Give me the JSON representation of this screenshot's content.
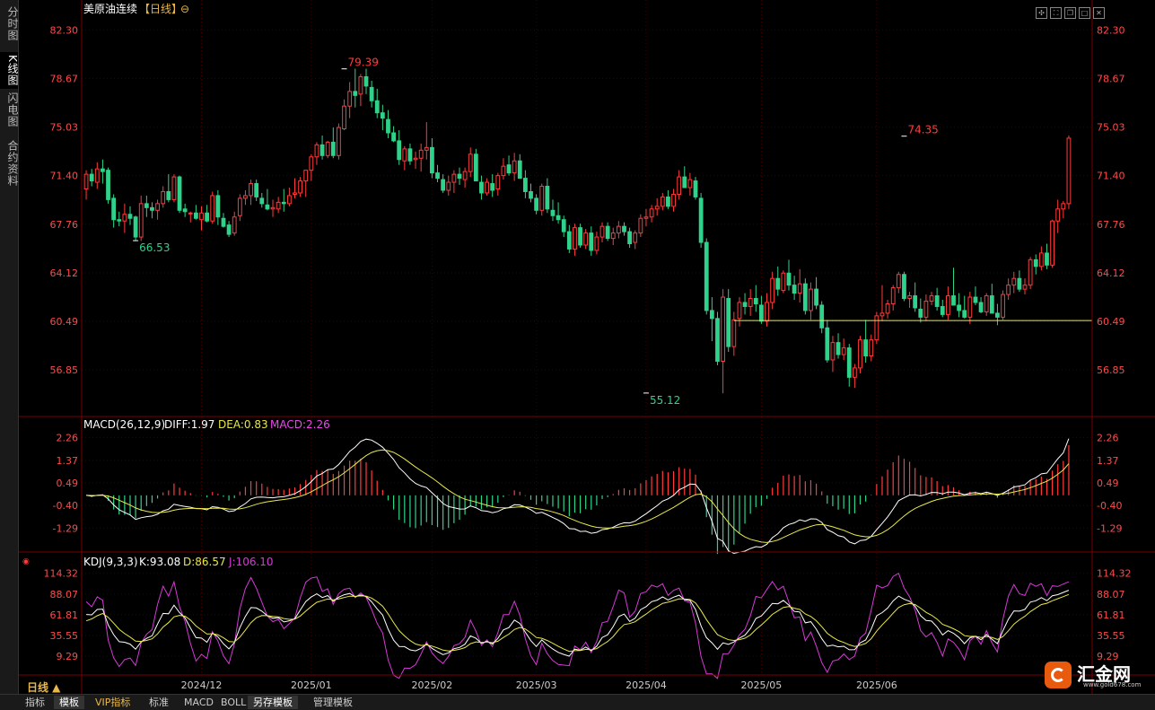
{
  "sidebar": {
    "tabs": [
      {
        "label": "分时图",
        "active": false
      },
      {
        "label": "K线图",
        "active": true
      },
      {
        "label": "闪电图",
        "active": false
      },
      {
        "label": "合约资料",
        "active": false
      }
    ]
  },
  "header": {
    "title": "美原油连续",
    "period_bracket": "【日线】",
    "settings_glyph": "⊖"
  },
  "window_icons": [
    "move-icon",
    "fullscreen-icon",
    "restore-icon",
    "max-icon",
    "close-icon"
  ],
  "period_label": "日线 ▲",
  "toolbar": {
    "buttons": [
      {
        "label": "指标",
        "active": false,
        "vip": false
      },
      {
        "label": "模板",
        "active": true,
        "vip": false
      },
      {
        "label": "VIP指标",
        "active": false,
        "vip": true
      },
      {
        "label": "标准",
        "active": false,
        "vip": false
      },
      {
        "label": "MACD",
        "active": false,
        "vip": false
      },
      {
        "label": "BOLL",
        "active": false,
        "vip": false
      },
      {
        "label": "另存模板",
        "active": true,
        "vip": false
      },
      {
        "label": "管理模板",
        "active": false,
        "vip": false
      }
    ]
  },
  "logo": {
    "text": "汇金网",
    "url": "www.gold678.com"
  },
  "colors": {
    "up": "#ff3b3b",
    "down": "#2fd28a",
    "price_axis": "#ff4a4a",
    "dea": "#e8e84a",
    "macd_label": "#e84ae8",
    "k": "#ffffff",
    "d": "#e8e84a",
    "j": "#d63ad6",
    "grid": "#3a0000",
    "hline": "#e8e85a"
  },
  "chart_data": [
    {
      "type": "candlestick",
      "yticks": [
        "82.30",
        "78.67",
        "75.03",
        "71.40",
        "67.76",
        "64.12",
        "60.49",
        "56.85"
      ],
      "ylim": [
        53.5,
        83.2
      ],
      "x_ticks": [
        {
          "label": "2024/12",
          "index": 21
        },
        {
          "label": "2025/01",
          "index": 41
        },
        {
          "label": "2025/02",
          "index": 63
        },
        {
          "label": "2025/03",
          "index": 82
        },
        {
          "label": "2025/04",
          "index": 102
        },
        {
          "label": "2025/05",
          "index": 123
        },
        {
          "label": "2025/06",
          "index": 144
        }
      ],
      "annotations": [
        {
          "text": "79.39",
          "index": 47,
          "value": 79.39,
          "kind": "high"
        },
        {
          "text": "66.53",
          "index": 9,
          "value": 66.53,
          "kind": "low"
        },
        {
          "text": "55.12",
          "index": 102,
          "value": 55.12,
          "kind": "low"
        },
        {
          "text": "74.35",
          "index": 149,
          "value": 74.35,
          "kind": "high"
        }
      ],
      "hline": {
        "value": 60.55,
        "from_index": 118,
        "to_index": 154
      },
      "ohlc": [
        [
          70.4,
          71.8,
          69.6,
          71.5
        ],
        [
          71.5,
          71.9,
          70.6,
          71.0
        ],
        [
          70.9,
          72.4,
          70.4,
          71.9
        ],
        [
          71.9,
          72.6,
          70.8,
          71.7
        ],
        [
          71.8,
          72.0,
          69.3,
          69.6
        ],
        [
          69.7,
          70.0,
          67.5,
          68.1
        ],
        [
          68.1,
          68.7,
          67.6,
          68.0
        ],
        [
          68.0,
          69.3,
          67.1,
          68.5
        ],
        [
          68.5,
          69.1,
          67.7,
          68.2
        ],
        [
          68.3,
          68.4,
          66.5,
          66.8
        ],
        [
          66.8,
          69.9,
          66.5,
          69.3
        ],
        [
          69.3,
          69.9,
          68.3,
          69.0
        ],
        [
          69.0,
          69.4,
          68.2,
          68.8
        ],
        [
          68.8,
          69.6,
          68.1,
          69.3
        ],
        [
          69.3,
          70.6,
          69.0,
          70.2
        ],
        [
          70.2,
          71.5,
          69.4,
          69.6
        ],
        [
          69.6,
          71.5,
          69.4,
          71.3
        ],
        [
          71.3,
          71.4,
          68.6,
          68.8
        ],
        [
          68.9,
          69.3,
          68.3,
          68.7
        ],
        [
          68.6,
          68.7,
          67.9,
          68.6
        ],
        [
          68.6,
          69.2,
          68.1,
          68.2
        ],
        [
          68.1,
          69.1,
          67.3,
          68.6
        ],
        [
          68.6,
          69.2,
          67.9,
          68.0
        ],
        [
          68.0,
          70.2,
          67.8,
          69.9
        ],
        [
          69.9,
          70.3,
          67.7,
          68.3
        ],
        [
          68.2,
          68.6,
          67.5,
          67.6
        ],
        [
          67.7,
          68.0,
          66.8,
          67.0
        ],
        [
          67.1,
          68.7,
          66.9,
          68.3
        ],
        [
          68.4,
          70.0,
          68.0,
          69.7
        ],
        [
          69.7,
          70.3,
          69.2,
          69.9
        ],
        [
          69.9,
          71.1,
          69.2,
          70.8
        ],
        [
          70.8,
          71.1,
          69.5,
          69.8
        ],
        [
          69.7,
          70.1,
          69.0,
          69.3
        ],
        [
          69.2,
          70.4,
          68.8,
          68.9
        ],
        [
          68.9,
          69.6,
          68.3,
          69.0
        ],
        [
          68.9,
          69.8,
          68.6,
          69.4
        ],
        [
          69.4,
          70.4,
          68.7,
          69.3
        ],
        [
          69.3,
          70.5,
          69.1,
          69.9
        ],
        [
          70.0,
          71.2,
          69.7,
          70.1
        ],
        [
          70.1,
          71.3,
          69.8,
          71.0
        ],
        [
          71.0,
          71.8,
          69.8,
          71.8
        ],
        [
          71.8,
          73.0,
          71.0,
          72.8
        ],
        [
          72.8,
          73.9,
          72.2,
          73.7
        ],
        [
          73.7,
          74.4,
          72.6,
          72.9
        ],
        [
          72.9,
          74.0,
          72.7,
          73.9
        ],
        [
          73.9,
          75.0,
          72.7,
          72.9
        ],
        [
          72.9,
          75.3,
          72.6,
          75.0
        ],
        [
          74.9,
          77.1,
          74.8,
          76.6
        ],
        [
          76.6,
          78.4,
          75.7,
          77.7
        ],
        [
          77.7,
          79.4,
          76.5,
          77.4
        ],
        [
          77.5,
          79.0,
          76.6,
          78.8
        ],
        [
          78.8,
          79.4,
          77.5,
          78.1
        ],
        [
          78.0,
          78.5,
          76.5,
          77.0
        ],
        [
          77.0,
          77.9,
          75.7,
          76.1
        ],
        [
          76.1,
          76.7,
          74.8,
          75.7
        ],
        [
          75.6,
          76.3,
          74.2,
          74.6
        ],
        [
          74.6,
          75.1,
          73.9,
          74.0
        ],
        [
          74.0,
          74.8,
          72.2,
          72.6
        ],
        [
          72.5,
          73.6,
          71.8,
          73.4
        ],
        [
          73.4,
          73.8,
          72.2,
          72.5
        ],
        [
          72.6,
          73.2,
          71.9,
          72.7
        ],
        [
          72.7,
          73.8,
          71.7,
          73.3
        ],
        [
          73.3,
          75.4,
          72.6,
          73.5
        ],
        [
          73.5,
          74.2,
          71.2,
          71.6
        ],
        [
          71.6,
          72.2,
          70.9,
          71.2
        ],
        [
          71.1,
          71.5,
          70.1,
          70.3
        ],
        [
          70.3,
          71.4,
          69.9,
          70.9
        ],
        [
          70.9,
          71.8,
          70.1,
          71.5
        ],
        [
          71.5,
          72.0,
          70.7,
          71.2
        ],
        [
          71.1,
          72.0,
          70.5,
          71.7
        ],
        [
          71.7,
          73.5,
          71.3,
          73.0
        ],
        [
          73.0,
          73.4,
          71.5,
          71.0
        ],
        [
          70.9,
          71.4,
          69.6,
          70.1
        ],
        [
          70.1,
          71.2,
          69.9,
          70.9
        ],
        [
          70.8,
          71.5,
          69.8,
          70.3
        ],
        [
          70.4,
          71.6,
          69.9,
          71.4
        ],
        [
          71.4,
          72.7,
          71.1,
          72.1
        ],
        [
          72.2,
          72.9,
          71.4,
          71.6
        ],
        [
          71.6,
          73.1,
          71.0,
          72.5
        ],
        [
          72.5,
          73.0,
          71.3,
          71.2
        ],
        [
          71.2,
          71.8,
          69.7,
          70.2
        ],
        [
          70.2,
          70.8,
          69.4,
          69.7
        ],
        [
          69.7,
          70.0,
          68.5,
          68.8
        ],
        [
          68.8,
          70.8,
          68.4,
          70.6
        ],
        [
          70.6,
          71.2,
          68.6,
          68.9
        ],
        [
          68.8,
          69.6,
          68.0,
          68.4
        ],
        [
          68.4,
          69.4,
          67.8,
          68.1
        ],
        [
          68.1,
          68.4,
          66.8,
          67.2
        ],
        [
          67.2,
          67.7,
          65.6,
          65.9
        ],
        [
          65.9,
          67.8,
          65.4,
          67.5
        ],
        [
          67.5,
          67.8,
          66.0,
          66.2
        ],
        [
          66.2,
          67.4,
          65.9,
          67.1
        ],
        [
          67.1,
          67.6,
          65.4,
          65.8
        ],
        [
          65.8,
          67.2,
          65.5,
          66.8
        ],
        [
          66.8,
          67.9,
          66.4,
          67.6
        ],
        [
          67.6,
          67.9,
          66.5,
          66.7
        ],
        [
          66.7,
          67.5,
          66.2,
          67.1
        ],
        [
          67.1,
          68.0,
          66.7,
          67.6
        ],
        [
          67.6,
          67.9,
          66.9,
          67.2
        ],
        [
          67.2,
          67.5,
          66.0,
          66.3
        ],
        [
          66.4,
          67.3,
          65.9,
          67.1
        ],
        [
          67.1,
          68.5,
          66.8,
          68.2
        ],
        [
          68.2,
          68.9,
          67.6,
          68.3
        ],
        [
          68.3,
          69.2,
          67.9,
          68.9
        ],
        [
          68.9,
          69.7,
          68.4,
          69.1
        ],
        [
          69.1,
          70.1,
          68.8,
          69.8
        ],
        [
          69.8,
          70.3,
          68.9,
          69.1
        ],
        [
          69.1,
          70.4,
          68.7,
          70.0
        ],
        [
          70.0,
          71.8,
          69.6,
          71.3
        ],
        [
          71.3,
          72.1,
          70.6,
          70.5
        ],
        [
          70.5,
          71.6,
          69.9,
          71.1
        ],
        [
          71.0,
          71.3,
          69.6,
          69.8
        ],
        [
          69.7,
          70.1,
          66.0,
          66.4
        ],
        [
          66.4,
          66.7,
          61.0,
          61.3
        ],
        [
          61.3,
          62.3,
          59.0,
          60.7
        ],
        [
          60.7,
          61.2,
          57.2,
          57.5
        ],
        [
          57.5,
          62.9,
          55.1,
          62.3
        ],
        [
          62.2,
          62.9,
          58.2,
          58.6
        ],
        [
          58.6,
          61.2,
          57.9,
          60.6
        ],
        [
          60.7,
          62.3,
          60.1,
          61.9
        ],
        [
          61.9,
          62.6,
          61.0,
          61.6
        ],
        [
          61.6,
          62.9,
          60.9,
          62.2
        ],
        [
          62.2,
          63.2,
          61.2,
          61.8
        ],
        [
          61.7,
          62.4,
          60.3,
          60.5
        ],
        [
          60.5,
          62.6,
          60.1,
          61.9
        ],
        [
          61.9,
          64.2,
          61.4,
          63.7
        ],
        [
          63.7,
          64.6,
          62.4,
          62.9
        ],
        [
          62.8,
          64.3,
          62.6,
          64.1
        ],
        [
          64.1,
          65.1,
          62.8,
          63.2
        ],
        [
          63.2,
          63.9,
          62.1,
          62.6
        ],
        [
          62.6,
          64.4,
          61.9,
          63.3
        ],
        [
          63.3,
          63.7,
          61.0,
          61.3
        ],
        [
          61.3,
          63.4,
          60.6,
          62.9
        ],
        [
          62.9,
          63.8,
          61.4,
          61.7
        ],
        [
          61.7,
          62.0,
          59.6,
          60.0
        ],
        [
          60.0,
          60.6,
          57.4,
          57.6
        ],
        [
          57.6,
          59.4,
          56.7,
          58.9
        ],
        [
          58.9,
          59.6,
          57.7,
          58.0
        ],
        [
          58.0,
          59.2,
          57.6,
          58.5
        ],
        [
          58.5,
          58.8,
          55.6,
          56.3
        ],
        [
          56.3,
          57.3,
          55.5,
          57.0
        ],
        [
          57.0,
          59.4,
          56.6,
          59.1
        ],
        [
          59.1,
          60.6,
          57.4,
          57.9
        ],
        [
          57.9,
          59.5,
          57.5,
          59.1
        ],
        [
          59.1,
          61.2,
          58.8,
          60.9
        ],
        [
          60.9,
          63.2,
          60.5,
          61.1
        ],
        [
          61.1,
          62.1,
          60.7,
          61.8
        ],
        [
          61.8,
          63.2,
          61.3,
          63.0
        ],
        [
          63.0,
          64.2,
          62.6,
          64.0
        ],
        [
          64.0,
          64.2,
          62.0,
          62.2
        ],
        [
          62.2,
          62.7,
          61.5,
          62.4
        ],
        [
          62.4,
          63.4,
          61.2,
          61.5
        ],
        [
          61.4,
          62.2,
          60.4,
          60.8
        ],
        [
          60.8,
          62.5,
          60.5,
          62.0
        ],
        [
          62.0,
          62.7,
          61.7,
          62.4
        ],
        [
          62.4,
          63.0,
          61.3,
          61.6
        ],
        [
          61.6,
          62.1,
          60.8,
          61.0
        ],
        [
          61.0,
          63.1,
          60.6,
          62.4
        ],
        [
          62.4,
          64.5,
          61.8,
          61.7
        ],
        [
          61.7,
          62.6,
          60.8,
          61.3
        ],
        [
          61.3,
          62.4,
          60.7,
          60.8
        ],
        [
          60.8,
          62.7,
          60.3,
          62.3
        ],
        [
          62.3,
          63.1,
          61.7,
          61.9
        ],
        [
          61.9,
          62.3,
          61.1,
          61.2
        ],
        [
          61.2,
          62.6,
          60.9,
          62.4
        ],
        [
          62.4,
          63.3,
          61.8,
          61.1
        ],
        [
          61.1,
          61.8,
          60.2,
          60.8
        ],
        [
          60.8,
          62.8,
          60.6,
          62.5
        ],
        [
          62.5,
          63.7,
          62.1,
          63.2
        ],
        [
          63.2,
          64.2,
          62.6,
          63.7
        ],
        [
          63.7,
          64.3,
          62.7,
          62.9
        ],
        [
          62.9,
          63.7,
          62.5,
          63.2
        ],
        [
          63.2,
          65.3,
          62.9,
          65.1
        ],
        [
          65.1,
          65.5,
          64.0,
          64.6
        ],
        [
          64.6,
          66.1,
          64.3,
          65.6
        ],
        [
          65.6,
          66.3,
          64.4,
          64.7
        ],
        [
          64.7,
          68.1,
          64.5,
          68.0
        ],
        [
          68.0,
          69.6,
          67.1,
          68.9
        ],
        [
          68.9,
          69.5,
          68.2,
          69.3
        ],
        [
          69.3,
          74.4,
          68.9,
          74.2
        ]
      ]
    },
    {
      "type": "line",
      "label": "MACD(26,12,9)",
      "labels": {
        "diff": "DIFF:1.97",
        "dea": "DEA:0.83",
        "macd": "MACD:2.26"
      },
      "yticks": [
        "2.26",
        "1.37",
        "0.49",
        "-0.40",
        "-1.29"
      ],
      "ylim": [
        -2.05,
        2.6
      ]
    },
    {
      "type": "line",
      "label": "KDJ(9,3,3)",
      "labels": {
        "k": "K:93.08",
        "d": "D:86.57",
        "j": "J:106.10"
      },
      "yticks": [
        "114.32",
        "88.07",
        "61.81",
        "35.55",
        "9.29"
      ],
      "ylim": [
        -10,
        122
      ]
    }
  ]
}
